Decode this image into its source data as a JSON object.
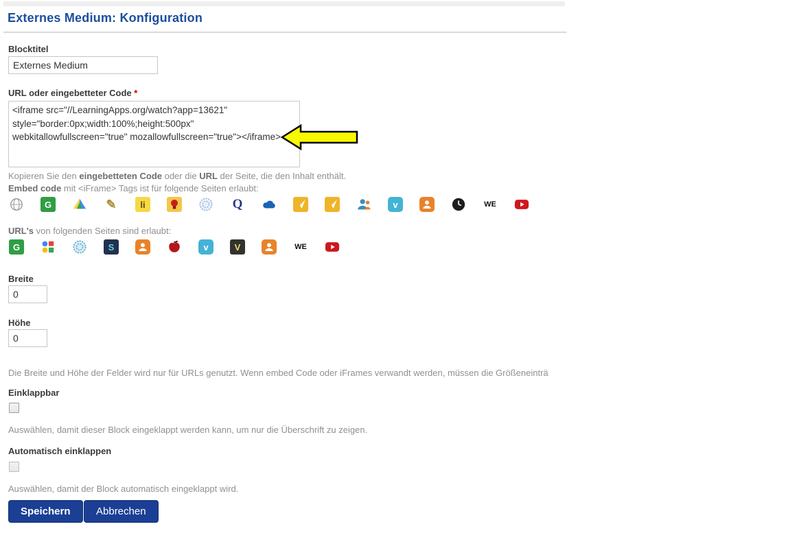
{
  "header": {
    "title": "Externes Medium: Konfiguration"
  },
  "form": {
    "blocktitel": {
      "label": "Blocktitel",
      "value": "Externes Medium"
    },
    "code": {
      "label": "URL oder eingebetteter Code ",
      "required": "*",
      "value": "<iframe src=\"//LearningApps.org/watch?app=13621\" style=\"border:0px;width:100%;height:500px\" webkitallowfullscreen=\"true\" mozallowfullscreen=\"true\"></iframe>",
      "help": {
        "copy_prefix": "Kopieren Sie den ",
        "copy_bold1": "eingebetteten Code",
        "copy_mid": " oder die ",
        "copy_bold2": "URL",
        "copy_suffix": " der Seite, die den Inhalt enthält.",
        "embed_bold": "Embed code",
        "embed_rest": " mit <iFrame> Tags ist für folgende Seiten erlaubt:",
        "url_bold": "URL's",
        "url_rest": " von folgenden Seiten sind erlaubt:"
      }
    },
    "breite": {
      "label": "Breite",
      "value": "0"
    },
    "hoehe": {
      "label": "Höhe",
      "value": "0"
    },
    "size_help": "Die Breite und Höhe der Felder wird nur für URLs genutzt. Wenn embed Code oder iFrames verwandt werden, müssen die Größeneinträ",
    "einklappbar": {
      "label": "Einklappbar",
      "checked": false,
      "help": "Auswählen, damit dieser Block eingeklappt werden kann, um nur die Überschrift zu zeigen."
    },
    "auto_einklappen": {
      "label": "Automatisch einklappen",
      "checked": false,
      "help": "Auswählen, damit der Block automatisch eingeklappt wird."
    },
    "buttons": {
      "save": "Speichern",
      "cancel": "Abbrechen"
    }
  },
  "embed_icons": [
    {
      "name": "globe-icon",
      "shape": "globe",
      "fg": "#9aa0a6"
    },
    {
      "name": "geogebra-icon",
      "shape": "tile",
      "glyph": "G",
      "bg": "#2f9e44",
      "fg": "#ffffff"
    },
    {
      "name": "google-drive-icon",
      "shape": "drive"
    },
    {
      "name": "pencil-icon",
      "shape": "letter",
      "glyph": "✎",
      "fg": "#b08d3e",
      "size": "18"
    },
    {
      "name": "learningapps-icon",
      "shape": "tile",
      "glyph": "li",
      "bg": "#f6d944",
      "fg": "#5b4a12"
    },
    {
      "name": "lightbulb-icon",
      "shape": "bulb",
      "bg": "#f2c84b",
      "fg": "#cc1b1b"
    },
    {
      "name": "dotted-globe-icon",
      "shape": "rings",
      "fg": "#8fb3dd",
      "bg": "#eaf1fa"
    },
    {
      "name": "quizlet-q-icon",
      "shape": "letter",
      "glyph": "Q",
      "fg": "#2b3a8f",
      "size": "19",
      "serif": true
    },
    {
      "name": "onedrive-cloud-icon",
      "shape": "cloud",
      "fg": "#1b63b5"
    },
    {
      "name": "dart-icon",
      "shape": "dart",
      "bg": "#f0b429",
      "fg": "#ffffff"
    },
    {
      "name": "dart-icon",
      "shape": "dart",
      "bg": "#f0b429",
      "fg": "#ffffff"
    },
    {
      "name": "slideshare-person-icon",
      "shape": "person2",
      "fg": "#3c8dbc",
      "fg2": "#e98325"
    },
    {
      "name": "vimeo-icon",
      "shape": "tile",
      "glyph": "v",
      "bg": "#44b3d5",
      "fg": "#ffffff",
      "rounded": true
    },
    {
      "name": "voki-person-icon",
      "shape": "person",
      "bg": "#e8832a",
      "fg": "#ffffff"
    },
    {
      "name": "clock-icon",
      "shape": "clock",
      "bg": "#1d1d1d",
      "fg": "#ffffff"
    },
    {
      "name": "wevideo-icon",
      "shape": "letter",
      "glyph": "WE",
      "fg": "#111111",
      "size": "11"
    },
    {
      "name": "youtube-icon",
      "shape": "youtube",
      "bg": "#cc181e",
      "fg": "#ffffff"
    }
  ],
  "url_icons": [
    {
      "name": "geogebra-icon",
      "shape": "tile",
      "glyph": "G",
      "bg": "#2f9e44",
      "fg": "#ffffff"
    },
    {
      "name": "google-icon",
      "shape": "google"
    },
    {
      "name": "rings-icon",
      "shape": "rings",
      "fg": "#4aa3c8",
      "bg": "#d9ecf5"
    },
    {
      "name": "swirl-s-icon",
      "shape": "tile",
      "glyph": "S",
      "bg": "#223150",
      "fg": "#66d0d8"
    },
    {
      "name": "voki-person-icon",
      "shape": "person",
      "bg": "#e8832a",
      "fg": "#ffffff"
    },
    {
      "name": "apple-icon",
      "shape": "apple",
      "fg": "#b3161b"
    },
    {
      "name": "vimeo-icon",
      "shape": "tile",
      "glyph": "v",
      "bg": "#44b3d5",
      "fg": "#ffffff",
      "rounded": true
    },
    {
      "name": "v-letter-icon",
      "shape": "tile",
      "glyph": "V",
      "bg": "#33332d",
      "fg": "#e6d87a"
    },
    {
      "name": "voki-person-icon",
      "shape": "person",
      "bg": "#e8832a",
      "fg": "#ffffff"
    },
    {
      "name": "wevideo-icon",
      "shape": "letter",
      "glyph": "WE",
      "fg": "#111111",
      "size": "11"
    },
    {
      "name": "youtube-icon",
      "shape": "youtube",
      "bg": "#cc181e",
      "fg": "#ffffff"
    }
  ],
  "annotation": {
    "arrow_fill": "#f8f800",
    "arrow_stroke": "#000000"
  }
}
